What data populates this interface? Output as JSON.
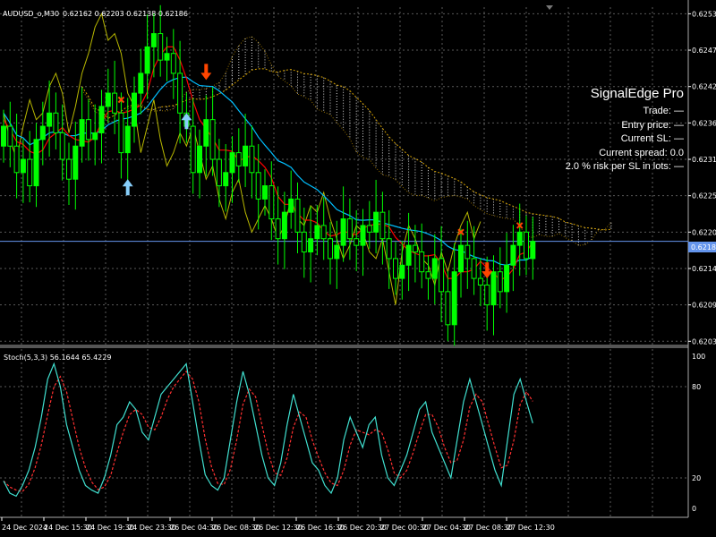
{
  "header": {
    "symbol": "AUDUSD_o,M30",
    "ohlc": "0.62162 0.62203 0.62138 0.62186"
  },
  "info_panel": {
    "title": "SignalEdge Pro",
    "rows": [
      "Trade: —",
      "Entry price: —",
      "Current SL: —",
      "Current spread: 0.0",
      "2.0 % risk per SL in lots: —"
    ]
  },
  "indicator": {
    "label": "Stoch(5,3,3) 56.1644 65.4229"
  },
  "colors": {
    "background": "#000000",
    "grid": "#5a5a5a",
    "bull_candle": "#00ff00",
    "bear_candle": "#000000",
    "cloud": "#ffffff",
    "senkou_b": "#d4a000",
    "tenkan": "#ff0000",
    "kijun": "#00bfff",
    "chikou": "#b8b800",
    "stoch_main": "#40e0d0",
    "stoch_signal": "#ff3030",
    "buy_arrow": "#87cefa",
    "sell_arrow": "#ff4500",
    "price_line": "#6495ed"
  },
  "current_price_label": "0.62186",
  "chart_data": [
    {
      "type": "candlestick",
      "title": "AUDUSD_o,M30",
      "ylim": [
        0.6203,
        0.6254
      ],
      "y_ticks": [
        "0.62530",
        "0.62475",
        "0.62420",
        "0.62365",
        "0.62310",
        "0.62255",
        "0.62200",
        "0.62145",
        "0.62090",
        "0.62035"
      ],
      "x_ticks": [
        "24 Dec 2024",
        "24 Dec 15:30",
        "24 Dec 19:30",
        "24 Dec 23:30",
        "26 Dec 04:30",
        "26 Dec 08:30",
        "26 Dec 12:30",
        "26 Dec 16:30",
        "26 Dec 20:30",
        "27 Dec 00:30",
        "27 Dec 04:30",
        "27 Dec 08:30",
        "27 Dec 12:30"
      ],
      "close": [
        0.6236,
        0.6233,
        0.6229,
        0.6231,
        0.6227,
        0.6234,
        0.6236,
        0.6238,
        0.6235,
        0.6231,
        0.6228,
        0.6233,
        0.6237,
        0.6234,
        0.6235,
        0.6239,
        0.6241,
        0.6238,
        0.6232,
        0.6236,
        0.6241,
        0.6244,
        0.6248,
        0.625,
        0.6246,
        0.6247,
        0.6244,
        0.6238,
        0.6236,
        0.6229,
        0.6233,
        0.6237,
        0.6231,
        0.6227,
        0.6229,
        0.6232,
        0.623,
        0.6233,
        0.6229,
        0.6225,
        0.6227,
        0.6222,
        0.6219,
        0.6223,
        0.6225,
        0.622,
        0.6217,
        0.6219,
        0.6221,
        0.6219,
        0.6216,
        0.6218,
        0.6222,
        0.6219,
        0.6218,
        0.6221,
        0.622,
        0.6223,
        0.6219,
        0.6216,
        0.6213,
        0.6215,
        0.6218,
        0.6217,
        0.6214,
        0.6213,
        0.6216,
        0.6211,
        0.6206,
        0.6214,
        0.6218,
        0.6216,
        0.6213,
        0.6212,
        0.6209,
        0.6214,
        0.6211,
        0.6215,
        0.6218,
        0.622,
        0.6216,
        0.62186
      ],
      "stochastic": {
        "label": "Stoch(5,3,3)",
        "main_last": 56.1644,
        "signal_last": 65.4229,
        "ylim": [
          0,
          100
        ],
        "levels": [
          20,
          80
        ],
        "y_ticks": [
          "100",
          "80",
          "20",
          "0"
        ],
        "main": [
          18,
          10,
          8,
          15,
          25,
          40,
          60,
          85,
          95,
          80,
          55,
          40,
          25,
          15,
          12,
          10,
          20,
          35,
          55,
          60,
          70,
          65,
          50,
          45,
          60,
          75,
          80,
          85,
          90,
          95,
          70,
          45,
          22,
          15,
          12,
          20,
          45,
          70,
          90,
          75,
          55,
          35,
          20,
          15,
          30,
          55,
          75,
          60,
          45,
          30,
          25,
          15,
          10,
          20,
          45,
          60,
          50,
          40,
          55,
          60,
          35,
          20,
          15,
          25,
          35,
          50,
          65,
          70,
          50,
          40,
          30,
          20,
          45,
          70,
          85,
          70,
          55,
          40,
          25,
          15,
          45,
          75,
          85,
          70,
          56
        ]
      }
    }
  ]
}
